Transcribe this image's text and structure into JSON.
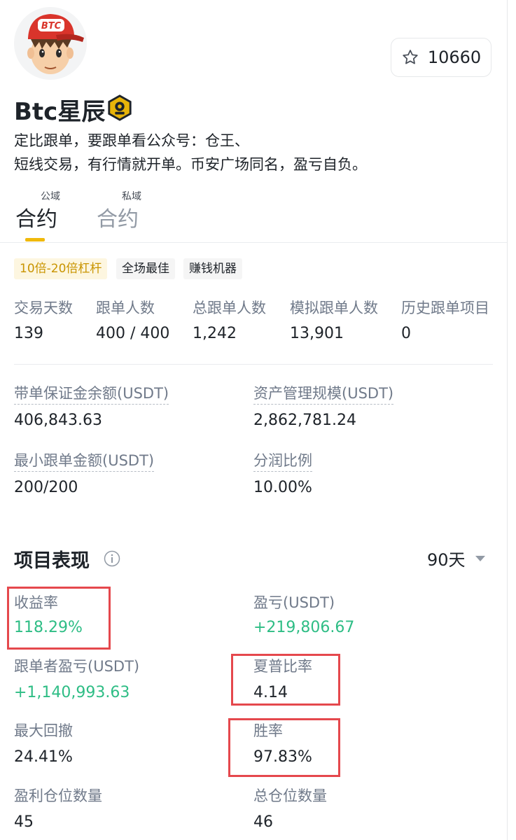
{
  "profile": {
    "avatar_text": "BTC",
    "name": "Btc星辰",
    "bio_line1": "定比跟单，要跟单看公众号：仓王、",
    "bio_line2": "短线交易，有行情就开单。币安广场同名，盈亏自负。",
    "follow_count": "10660"
  },
  "tabs": [
    {
      "superscript": "公域",
      "label": "合约",
      "active": true
    },
    {
      "superscript": "私域",
      "label": "合约",
      "active": false
    }
  ],
  "tags": [
    "10倍-20倍杠杆",
    "全场最佳",
    "赚钱机器"
  ],
  "stats": [
    {
      "label": "交易天数",
      "value": "139"
    },
    {
      "label": "跟单人数",
      "value": "400 / 400"
    },
    {
      "label": "总跟单人数",
      "value": "1,242"
    },
    {
      "label": "模拟跟单人数",
      "value": "13,901"
    },
    {
      "label": "历史跟单项目",
      "value": "0"
    }
  ],
  "financials": [
    {
      "label": "带单保证金余额(USDT)",
      "value": "406,843.63"
    },
    {
      "label": "资产管理规模(USDT)",
      "value": "2,862,781.24"
    },
    {
      "label": "最小跟单金额(USDT)",
      "value": "200/200"
    },
    {
      "label": "分润比例",
      "value": "10.00%"
    }
  ],
  "performance": {
    "title": "项目表现",
    "period": "90天",
    "metrics": [
      {
        "label": "收益率",
        "value": "118.29%",
        "positive": true
      },
      {
        "label": "盈亏(USDT)",
        "value": "+219,806.67",
        "positive": true
      },
      {
        "label": "跟单者盈亏(USDT)",
        "value": "+1,140,993.63",
        "positive": true
      },
      {
        "label": "夏普比率",
        "value": "4.14",
        "positive": false
      },
      {
        "label": "最大回撤",
        "value": "24.41%",
        "positive": false
      },
      {
        "label": "胜率",
        "value": "97.83%",
        "positive": false
      },
      {
        "label": "盈利仓位数量",
        "value": "45",
        "positive": false
      },
      {
        "label": "总仓位数量",
        "value": "46",
        "positive": false
      }
    ]
  },
  "colors": {
    "accent": "#f0b90b",
    "positive": "#2ebd85",
    "highlight": "#e5484d"
  }
}
